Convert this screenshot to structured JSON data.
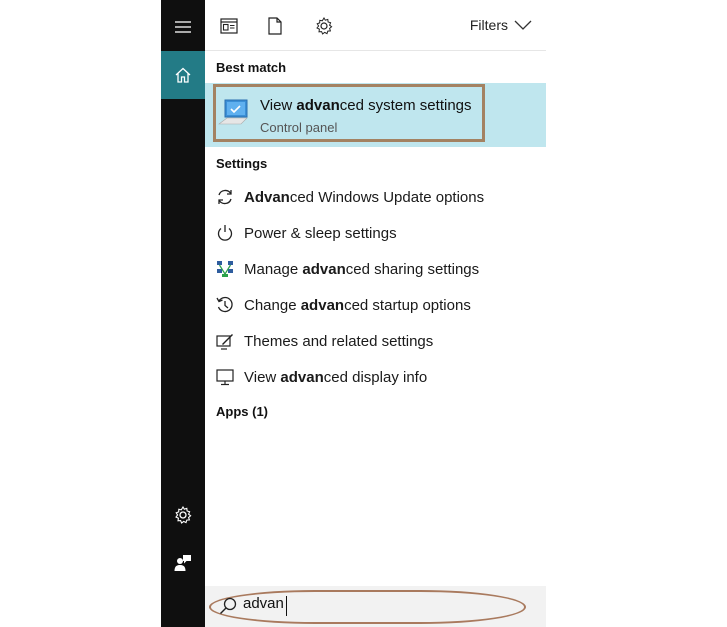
{
  "rail": {
    "items": [
      {
        "name": "menu",
        "icon": "hamburger-icon"
      },
      {
        "name": "home",
        "icon": "home-icon",
        "active": true
      },
      {
        "name": "settings",
        "icon": "gear-icon"
      },
      {
        "name": "feedback",
        "icon": "feedback-icon"
      }
    ],
    "accent": "#237b86"
  },
  "topbar": {
    "icons": [
      "apps-icon",
      "documents-icon",
      "settings-icon"
    ],
    "filters_label": "Filters"
  },
  "best_match": {
    "section_label": "Best match",
    "title_pre": "View ",
    "title_bold": "advan",
    "title_post": "ced system settings",
    "subtitle": "Control panel",
    "highlight": "#bfe6ee"
  },
  "settings": {
    "section_label": "Settings",
    "items": [
      {
        "icon": "sync-icon",
        "pre": "",
        "bold": "Advan",
        "post": "ced Windows Update options"
      },
      {
        "icon": "power-icon",
        "pre": "Power & sleep settings",
        "bold": "",
        "post": ""
      },
      {
        "icon": "network-icon",
        "pre": "Manage ",
        "bold": "advan",
        "post": "ced sharing settings"
      },
      {
        "icon": "history-icon",
        "pre": "Change ",
        "bold": "advan",
        "post": "ced startup options"
      },
      {
        "icon": "themes-icon",
        "pre": "Themes and related settings",
        "bold": "",
        "post": ""
      },
      {
        "icon": "monitor-icon",
        "pre": "View ",
        "bold": "advan",
        "post": "ced display info"
      }
    ]
  },
  "apps": {
    "section_label": "Apps (1)"
  },
  "search": {
    "value": "advan",
    "placeholder": ""
  }
}
